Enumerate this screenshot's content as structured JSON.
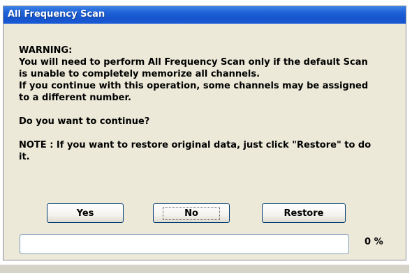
{
  "window": {
    "title": "All Frequency Scan"
  },
  "message": {
    "warning": "WARNING:",
    "line1": "You will need to perform All Frequency Scan only if the default Scan",
    "line2": "is unable to completely memorize all channels.",
    "line3": "If you continue with this operation, some channels may be assigned",
    "line4": "to a different number.",
    "question": "Do you want to continue?",
    "note1": "NOTE : If you want to restore original data, just click \"Restore\" to do",
    "note2": "it."
  },
  "buttons": {
    "yes_label": "Yes",
    "no_label": "No",
    "restore_label": "Restore"
  },
  "progress": {
    "value": 0,
    "percent_text": "0 %"
  },
  "colors": {
    "titlebar": "#1f62d8",
    "dialog_bg": "#ece9d8",
    "button_border": "#003c74"
  }
}
